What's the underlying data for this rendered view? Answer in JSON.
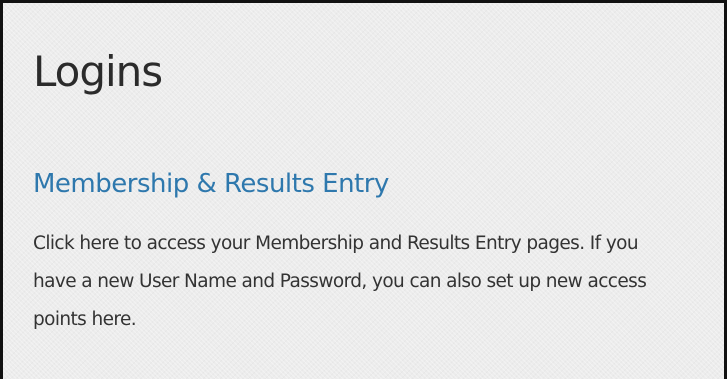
{
  "page": {
    "title": "Logins"
  },
  "section": {
    "link_label": "Membership & Results Entry",
    "description": "Click here to access your Membership and Results Entry pages. If you have a new User Name and Password, you can also set up new access points here."
  }
}
